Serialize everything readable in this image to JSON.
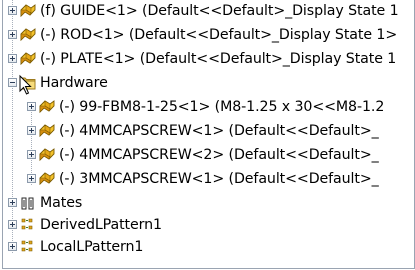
{
  "tree": {
    "items": [
      {
        "label": "(f) GUIDE<1> (Default<<Default>_Display State 1",
        "icon": "part-icon",
        "toggle": "plus"
      },
      {
        "label": "(-) ROD<1> (Default<<Default>_Display State 1>",
        "icon": "part-icon",
        "toggle": "plus"
      },
      {
        "label": "(-) PLATE<1> (Default<<Default>_Display State 1",
        "icon": "part-icon",
        "toggle": "plus"
      },
      {
        "label": "Hardware",
        "icon": "folder-icon",
        "toggle": "minus"
      },
      {
        "label": "(-) 99-FBM8-1-25<1> (M8-1.25 x 30<<M8-1.2",
        "icon": "part-icon",
        "toggle": "plus"
      },
      {
        "label": "(-) 4MMCAPSCREW<1> (Default<<Default>_",
        "icon": "part-icon",
        "toggle": "plus"
      },
      {
        "label": "(-) 4MMCAPSCREW<2> (Default<<Default>_",
        "icon": "part-icon",
        "toggle": "plus"
      },
      {
        "label": "(-) 3MMCAPSCREW<1> (Default<<Default>_",
        "icon": "part-icon",
        "toggle": "plus"
      },
      {
        "label": "Mates",
        "icon": "mates-icon",
        "toggle": "plus"
      },
      {
        "label": "DerivedLPattern1",
        "icon": "pattern-icon",
        "toggle": "plus"
      },
      {
        "label": "LocalLPattern1",
        "icon": "pattern-icon",
        "toggle": "plus"
      }
    ]
  }
}
